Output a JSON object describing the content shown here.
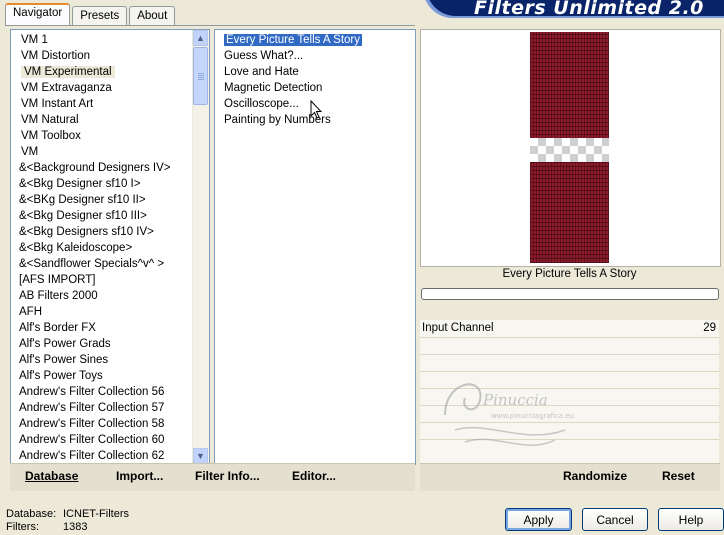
{
  "app": {
    "title": "Filters Unlimited 2.0"
  },
  "tabs": [
    {
      "label": "Navigator"
    },
    {
      "label": "Presets"
    },
    {
      "label": "About"
    }
  ],
  "categories": {
    "items": [
      "VM 1",
      "VM Distortion",
      "VM Experimental",
      "VM Extravaganza",
      "VM Instant Art",
      "VM Natural",
      "VM Toolbox",
      "VM",
      "&<Background Designers IV>",
      "&<Bkg Designer sf10 I>",
      "&<BKg Designer sf10 II>",
      "&<Bkg Designer sf10 III>",
      "&<Bkg Designers sf10 IV>",
      "&<Bkg Kaleidoscope>",
      "&<Sandflower Specials^v^ >",
      "[AFS IMPORT]",
      "AB Filters 2000",
      "AFH",
      "Alf's Border FX",
      "Alf's Power Grads",
      "Alf's Power Sines",
      "Alf's Power Toys",
      "Andrew's Filter Collection 56",
      "Andrew's Filter Collection 57",
      "Andrew's Filter Collection 58",
      "Andrew's Filter Collection 60",
      "Andrew's Filter Collection 62"
    ],
    "selected_index": 2
  },
  "filters": {
    "items": [
      "Every Picture Tells A Story",
      "Guess  What?...",
      "Love and Hate",
      "Magnetic Detection",
      "Oscilloscope...",
      "Painting by Numbers"
    ],
    "selected_index": 0
  },
  "preview": {
    "caption": "Every Picture Tells A Story",
    "progress": 0,
    "image_color": "#8c1a2a"
  },
  "sliders": [
    {
      "label": "Input Channel",
      "value": "29"
    }
  ],
  "watermark_text": "Pinuccia",
  "watermark_sub": "www.pinucciagrafica.eu",
  "bar": {
    "database": "Database",
    "import": "Import...",
    "filter_info": "Filter Info...",
    "editor": "Editor...",
    "randomize": "Randomize",
    "reset": "Reset"
  },
  "status": {
    "database_key": "Database:",
    "database_value": "ICNET-Filters",
    "filters_key": "Filters:",
    "filters_value": "1383"
  },
  "buttons": {
    "apply": "Apply",
    "cancel": "Cancel",
    "help": "Help"
  }
}
